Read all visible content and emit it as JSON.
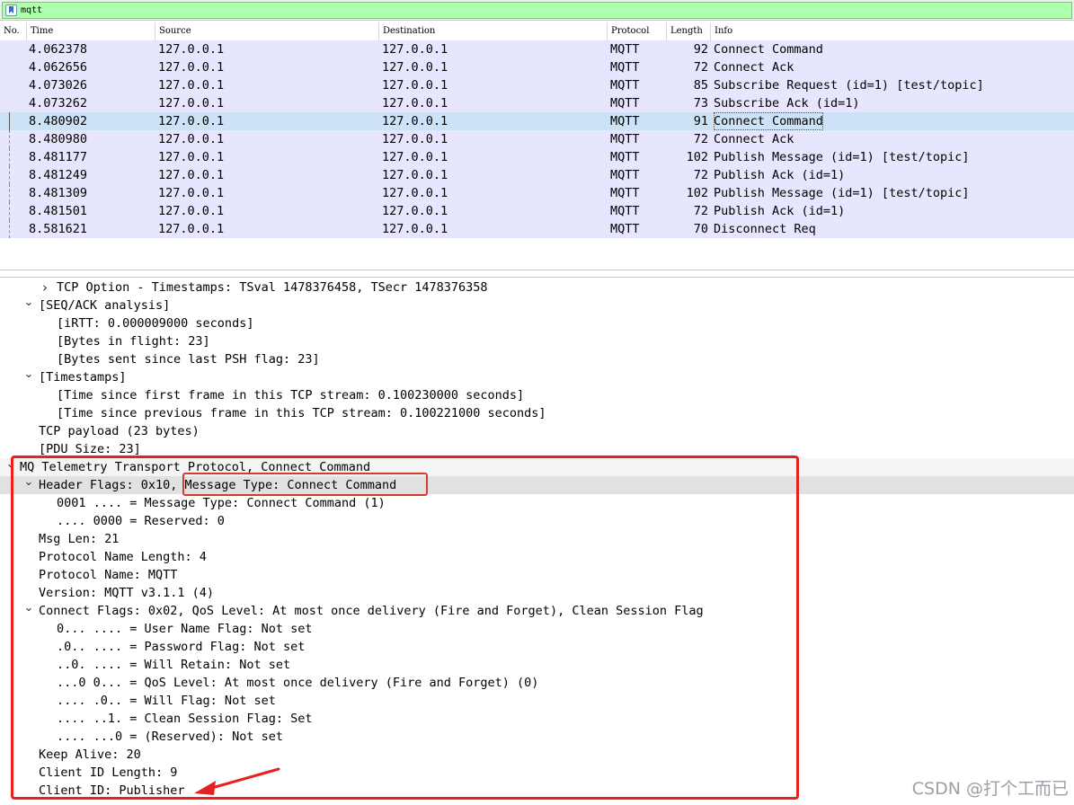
{
  "filter": {
    "value": "mqtt"
  },
  "columns": [
    "No.",
    "Time",
    "Source",
    "Destination",
    "Protocol",
    "Length",
    "Info"
  ],
  "packets": [
    {
      "time": "4.062378",
      "src": "127.0.0.1",
      "dst": "127.0.0.1",
      "proto": "MQTT",
      "len": "92",
      "info": "Connect Command"
    },
    {
      "time": "4.062656",
      "src": "127.0.0.1",
      "dst": "127.0.0.1",
      "proto": "MQTT",
      "len": "72",
      "info": "Connect Ack"
    },
    {
      "time": "4.073026",
      "src": "127.0.0.1",
      "dst": "127.0.0.1",
      "proto": "MQTT",
      "len": "85",
      "info": "Subscribe Request (id=1) [test/topic]"
    },
    {
      "time": "4.073262",
      "src": "127.0.0.1",
      "dst": "127.0.0.1",
      "proto": "MQTT",
      "len": "73",
      "info": "Subscribe Ack (id=1)"
    },
    {
      "time": "8.480902",
      "src": "127.0.0.1",
      "dst": "127.0.0.1",
      "proto": "MQTT",
      "len": "91",
      "info": "Connect Command",
      "selected": true
    },
    {
      "time": "8.480980",
      "src": "127.0.0.1",
      "dst": "127.0.0.1",
      "proto": "MQTT",
      "len": "72",
      "info": "Connect Ack"
    },
    {
      "time": "8.481177",
      "src": "127.0.0.1",
      "dst": "127.0.0.1",
      "proto": "MQTT",
      "len": "102",
      "info": "Publish Message (id=1) [test/topic]"
    },
    {
      "time": "8.481249",
      "src": "127.0.0.1",
      "dst": "127.0.0.1",
      "proto": "MQTT",
      "len": "72",
      "info": "Publish Ack (id=1)"
    },
    {
      "time": "8.481309",
      "src": "127.0.0.1",
      "dst": "127.0.0.1",
      "proto": "MQTT",
      "len": "102",
      "info": "Publish Message (id=1) [test/topic]"
    },
    {
      "time": "8.481501",
      "src": "127.0.0.1",
      "dst": "127.0.0.1",
      "proto": "MQTT",
      "len": "72",
      "info": "Publish Ack (id=1)"
    },
    {
      "time": "8.581621",
      "src": "127.0.0.1",
      "dst": "127.0.0.1",
      "proto": "MQTT",
      "len": "70",
      "info": "Disconnect Req"
    }
  ],
  "tree": [
    {
      "level": 2,
      "arrow": "right",
      "text": "TCP Option - Timestamps: TSval 1478376458, TSecr 1478376358"
    },
    {
      "level": 1,
      "arrow": "down",
      "text": "[SEQ/ACK analysis]"
    },
    {
      "level": 2,
      "text": "[iRTT: 0.000009000 seconds]"
    },
    {
      "level": 2,
      "text": "[Bytes in flight: 23]"
    },
    {
      "level": 2,
      "text": "[Bytes sent since last PSH flag: 23]"
    },
    {
      "level": 1,
      "arrow": "down",
      "text": "[Timestamps]"
    },
    {
      "level": 2,
      "text": "[Time since first frame in this TCP stream: 0.100230000 seconds]"
    },
    {
      "level": 2,
      "text": "[Time since previous frame in this TCP stream: 0.100221000 seconds]"
    },
    {
      "level": 1,
      "text": "TCP payload (23 bytes)"
    },
    {
      "level": 1,
      "text": "[PDU Size: 23]"
    },
    {
      "level": 0,
      "arrow": "down",
      "text": "MQ Telemetry Transport Protocol, Connect Command",
      "section": true
    },
    {
      "level": 1,
      "arrow": "down",
      "text": "Header Flags: 0x10, Message Type: Connect Command",
      "highlight": true
    },
    {
      "level": 2,
      "text": "0001 .... = Message Type: Connect Command (1)"
    },
    {
      "level": 2,
      "text": ".... 0000 = Reserved: 0"
    },
    {
      "level": 1,
      "text": "Msg Len: 21"
    },
    {
      "level": 1,
      "text": "Protocol Name Length: 4"
    },
    {
      "level": 1,
      "text": "Protocol Name: MQTT"
    },
    {
      "level": 1,
      "text": "Version: MQTT v3.1.1 (4)"
    },
    {
      "level": 1,
      "arrow": "down",
      "text": "Connect Flags: 0x02, QoS Level: At most once delivery (Fire and Forget), Clean Session Flag"
    },
    {
      "level": 2,
      "text": "0... .... = User Name Flag: Not set"
    },
    {
      "level": 2,
      "text": ".0.. .... = Password Flag: Not set"
    },
    {
      "level": 2,
      "text": "..0. .... = Will Retain: Not set"
    },
    {
      "level": 2,
      "text": "...0 0... = QoS Level: At most once delivery (Fire and Forget) (0)"
    },
    {
      "level": 2,
      "text": ".... .0.. = Will Flag: Not set"
    },
    {
      "level": 2,
      "text": ".... ..1. = Clean Session Flag: Set"
    },
    {
      "level": 2,
      "text": ".... ...0 = (Reserved): Not set"
    },
    {
      "level": 1,
      "text": "Keep Alive: 20"
    },
    {
      "level": 1,
      "text": "Client ID Length: 9"
    },
    {
      "level": 1,
      "text": "Client ID: Publisher"
    }
  ],
  "watermark": "CSDN @打个工而已",
  "colors": {
    "filter_ok": "#afffaf",
    "row_bg": "#e7e6ff",
    "selected_bg": "#cce3f7",
    "annotation_red": "#e8201f"
  }
}
